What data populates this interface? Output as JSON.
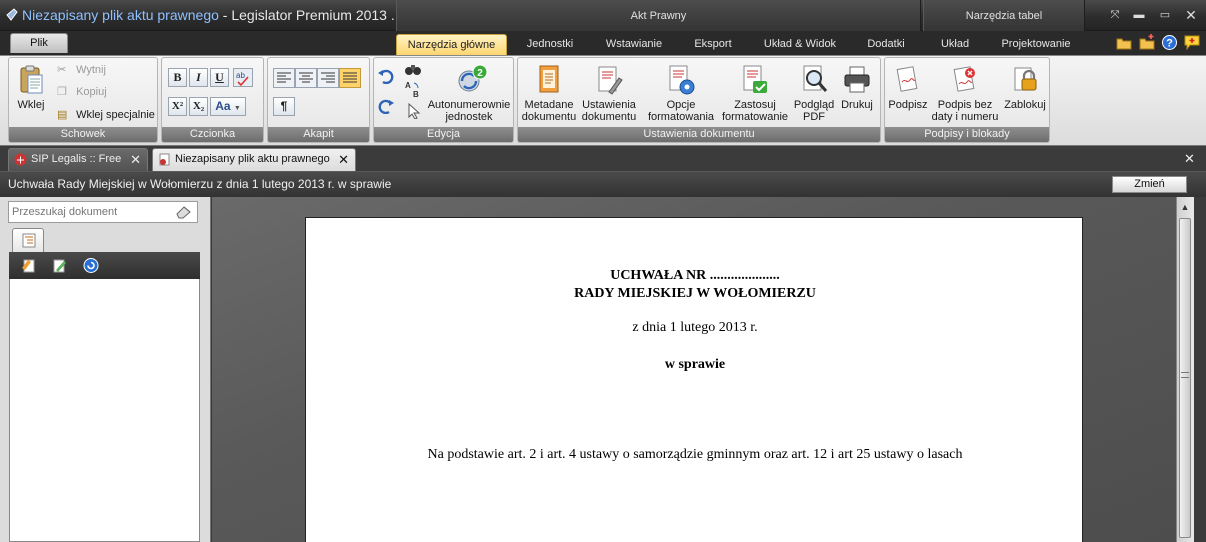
{
  "window": {
    "doc_name": "Niezapisany plik aktu prawnego",
    "app_name": " - Legislator Premium 2013 ..."
  },
  "context_groups": {
    "akt_prawny": "Akt Prawny",
    "narzedzia_tabel": "Narzędzia tabel"
  },
  "ribbon_tabs": {
    "file": "Plik",
    "tabs": [
      "Narzędzia główne",
      "Jednostki",
      "Wstawianie",
      "Eksport",
      "Układ & Widok",
      "Dodatki",
      "Układ",
      "Projektowanie"
    ],
    "active": "Narzędzia główne"
  },
  "clipboard": {
    "paste": "Wklej",
    "cut": "Wytnij",
    "copy": "Kopiuj",
    "paste_special": "Wklej specjalnie",
    "label": "Schowek"
  },
  "font": {
    "bold": "B",
    "italic": "I",
    "underline": "U",
    "superscript": "X²",
    "subscript": "X₂",
    "case": "Aa",
    "label": "Czcionka"
  },
  "paragraph": {
    "pilcrow": "¶",
    "label": "Akapit"
  },
  "editing": {
    "autonumber_line1": "Autonumerownie",
    "autonumber_line2": "jednostek",
    "label": "Edycja"
  },
  "doc_settings": {
    "metadata_l1": "Metadane",
    "metadata_l2": "dokumentu",
    "settings_l1": "Ustawienia",
    "settings_l2": "dokumentu",
    "options_l1": "Opcje",
    "options_l2": "formatowania",
    "apply_l1": "Zastosuj",
    "apply_l2": "formatowanie",
    "preview_l1": "Podgląd",
    "preview_l2": "PDF",
    "print": "Drukuj",
    "label": "Ustawienia dokumentu"
  },
  "signatures": {
    "sign": "Podpisz",
    "sign_nodate_l1": "Podpis bez",
    "sign_nodate_l2": "daty i numeru",
    "lock": "Zablokuj",
    "label": "Podpisy i blokady"
  },
  "doc_tabs": {
    "tab1": "SIP Legalis :: Free",
    "tab2": "Niezapisany plik aktu prawnego",
    "close": "✕"
  },
  "doc_header": {
    "title": "Uchwała Rady Miejskiej w Wołomierzu z dnia 1 lutego 2013 r. w sprawie",
    "change_button": "Zmień"
  },
  "left_pane": {
    "search_placeholder": "Przeszukaj dokument"
  },
  "document": {
    "heading1": "UCHWAŁA NR ....................",
    "heading2": "RADY MIEJSKIEJ W WOŁOMIERZU",
    "date": "z dnia 1 lutego 2013 r.",
    "subject": "w sprawie",
    "basis": "Na podstawie art. 2 i art. 4 ustawy o samorządzie gminnym oraz art. 12 i art 25 ustawy o lasach"
  }
}
